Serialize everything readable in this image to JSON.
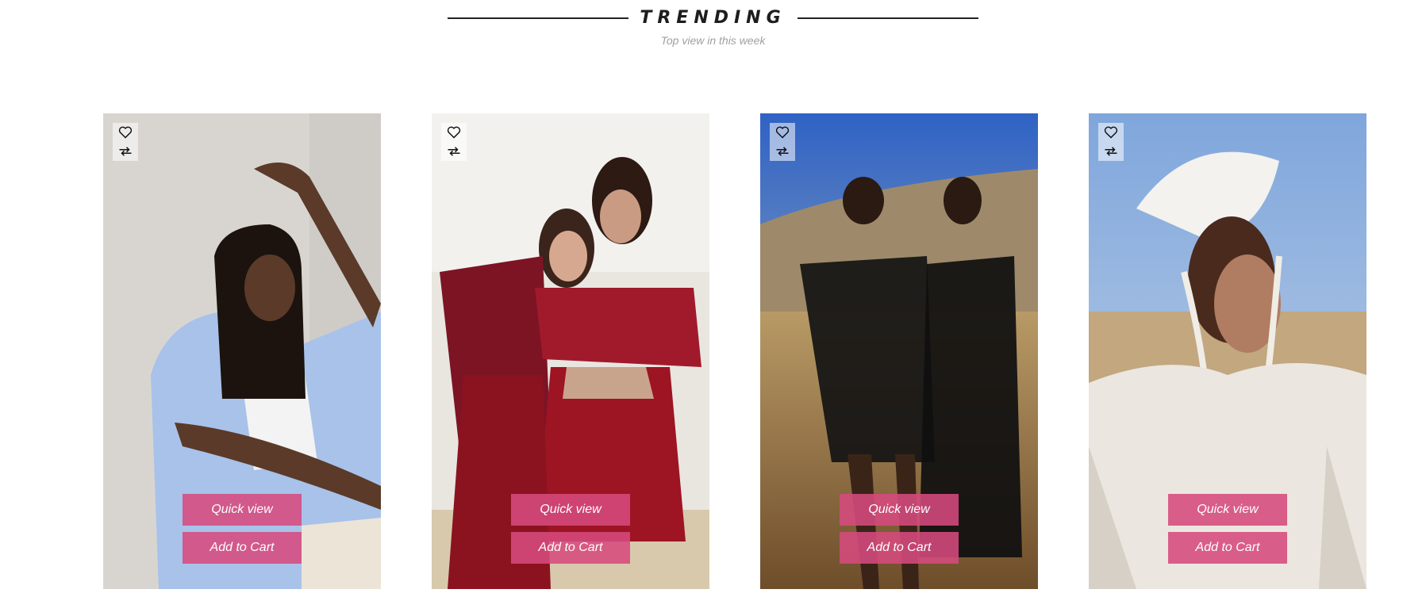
{
  "section": {
    "title": "TRENDING",
    "subtitle": "Top view in this week"
  },
  "products": [
    {
      "image_desc": "woman-light-blue-jacket",
      "quick_view_label": "Quick view",
      "add_to_cart_label": "Add to Cart",
      "bg": "#d9d6d2"
    },
    {
      "image_desc": "two-women-red-sequin",
      "quick_view_label": "Quick view",
      "add_to_cart_label": "Add to Cart",
      "bg": "#e8e4de"
    },
    {
      "image_desc": "two-women-black-dresses-desert",
      "quick_view_label": "Quick view",
      "add_to_cart_label": "Add to Cart",
      "bg": "#3b6bbf"
    },
    {
      "image_desc": "woman-feather-headpiece",
      "quick_view_label": "Quick view",
      "add_to_cart_label": "Add to Cart",
      "bg": "#9bbde0"
    }
  ],
  "icons": {
    "wishlist": "heart-icon",
    "compare": "compare-arrows-icon"
  },
  "colors": {
    "button_bg": "#d64a7d",
    "button_text": "#ffffff",
    "title": "#1d1d1d",
    "subtitle": "#a0a0a0"
  }
}
